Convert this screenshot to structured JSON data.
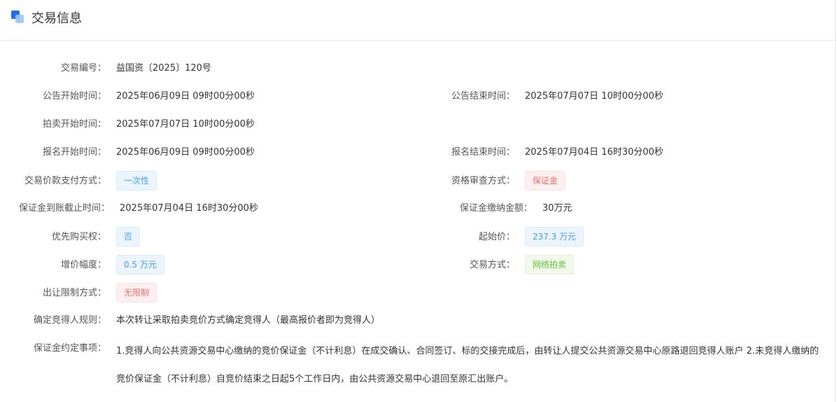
{
  "header": {
    "title": "交易信息"
  },
  "fields": {
    "trade_no": {
      "label": "交易编号：",
      "value": "益国资〔2025〕120号"
    },
    "notice_start": {
      "label": "公告开始时间：",
      "value": "2025年06月09日 09时00分00秒"
    },
    "notice_end": {
      "label": "公告结束时间：",
      "value": "2025年07月07日 10时00分00秒"
    },
    "auction_start": {
      "label": "拍卖开始时间：",
      "value": "2025年07月07日 10时00分00秒"
    },
    "signup_start": {
      "label": "报名开始时间：",
      "value": "2025年06月09日 09时00分00秒"
    },
    "signup_end": {
      "label": "报名结束时间：",
      "value": "2025年07月04日 16时30分00秒"
    },
    "payment_method": {
      "label": "交易价款支付方式：",
      "value": "一次性"
    },
    "qualification": {
      "label": "资格审查方式：",
      "value": "保证金"
    },
    "deposit_deadline": {
      "label": "保证金到账截止时间：",
      "value": "2025年07月04日 16时30分00秒"
    },
    "deposit_amount": {
      "label": "保证金缴纳金额：",
      "value": "30万元"
    },
    "priority": {
      "label": "优先购买权：",
      "value": "否"
    },
    "start_price": {
      "label": "起始价：",
      "value": "237.3 万元"
    },
    "increment": {
      "label": "增价幅度：",
      "value": "0.5 万元"
    },
    "trade_method": {
      "label": "交易方式：",
      "value": "网络拍卖"
    },
    "restriction": {
      "label": "出让限制方式：",
      "value": "无限制"
    },
    "bidder_rule": {
      "label": "确定竞得人规则：",
      "value": "本次转让采取拍卖竞价方式确定竞得人（最高报价者即为竞得人）"
    },
    "deposit_terms": {
      "label": "保证金约定事项：",
      "value": "1.竞得人向公共资源交易中心缴纳的竞价保证金（不计利息）在成交确认、合同签订、标的交接完成后，由转让人提交公共资源交易中心原路退回竞得人账户 2.未竞得人缴纳的竞价保证金（不计利息）自竞价结束之日起5个工作日内，由公共资源交易中心退回至原汇出账户。"
    }
  },
  "colors": {
    "accent": "#1f6fe0",
    "tag_blue": "#409eff",
    "tag_red": "#f56c6c",
    "tag_green": "#67c23a"
  }
}
